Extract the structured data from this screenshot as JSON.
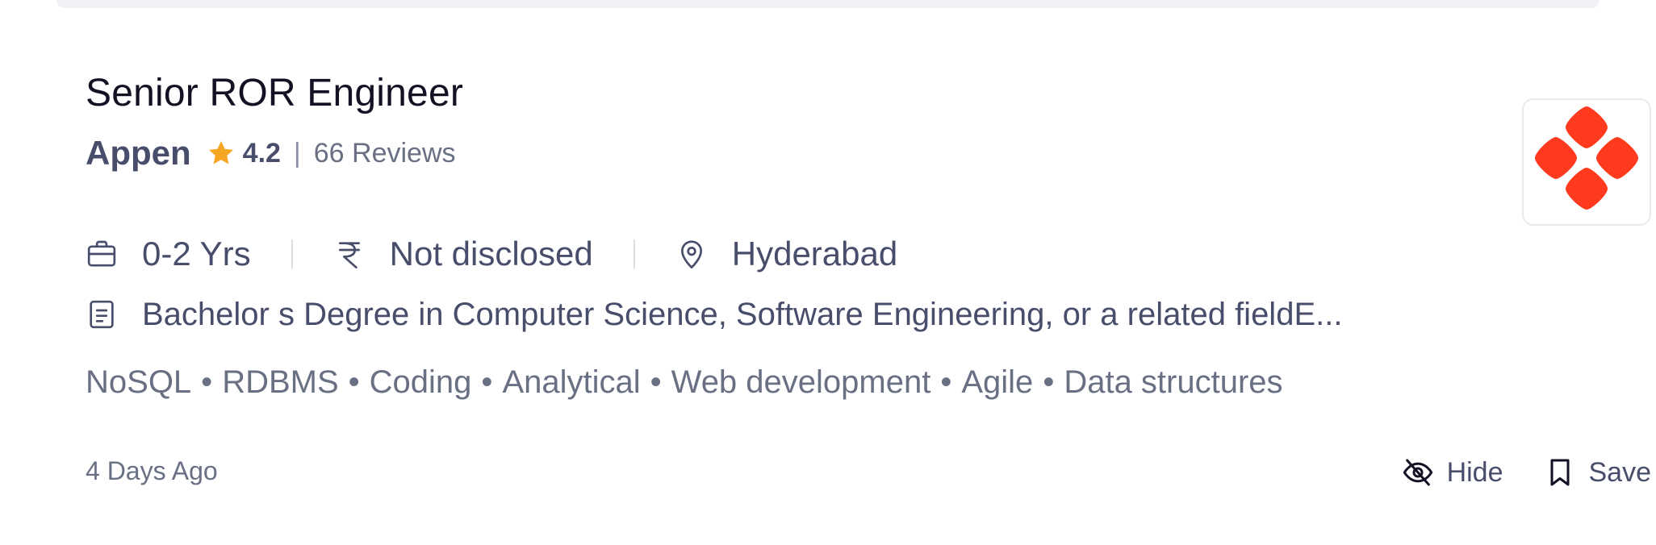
{
  "job": {
    "title": "Senior ROR Engineer",
    "company": "Appen",
    "rating": "4.2",
    "rating_separator": "|",
    "reviews": "66 Reviews",
    "logo_icon": "appen-logo",
    "logo_color": "#ff3a1f",
    "star_color": "#f5a623",
    "experience": "0-2 Yrs",
    "salary": "Not disclosed",
    "location": "Hyderabad",
    "description": "Bachelor s Degree in Computer Science, Software Engineering, or a related fieldE...",
    "tags": [
      "NoSQL",
      "RDBMS",
      "Coding",
      "Analytical",
      "Web development",
      "Agile",
      "Data structures"
    ],
    "tag_separator": "•",
    "posted": "4 Days Ago"
  },
  "actions": {
    "hide_label": "Hide",
    "save_label": "Save"
  },
  "icons": {
    "experience": "briefcase-icon",
    "salary": "rupee-icon",
    "location": "location-pin-icon",
    "description": "document-icon",
    "hide": "eye-off-icon",
    "save": "bookmark-icon",
    "rating": "star-icon"
  }
}
